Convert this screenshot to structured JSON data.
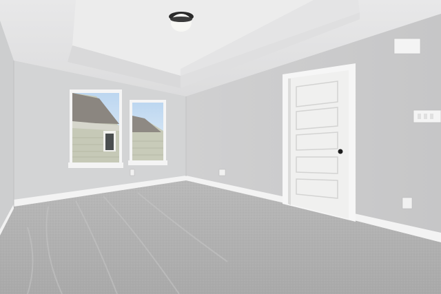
{
  "scene": {
    "description_tags": [
      "empty-bedroom",
      "tray-ceiling",
      "carpet",
      "two-windows",
      "paneled-door"
    ],
    "colors": {
      "wall_left": "#d2d3d4",
      "wall_back": "#cfcfd0",
      "wall_right": "#cbcbcc",
      "ceiling": "#e3e3e4",
      "tray": "#ececec",
      "carpet": "#b3b3b3",
      "trim": "#f4f4f4",
      "door": "#f1f1f0",
      "sky": "#cfe3f6",
      "roof": "#8a857e",
      "siding": "#c9cbbb"
    }
  }
}
